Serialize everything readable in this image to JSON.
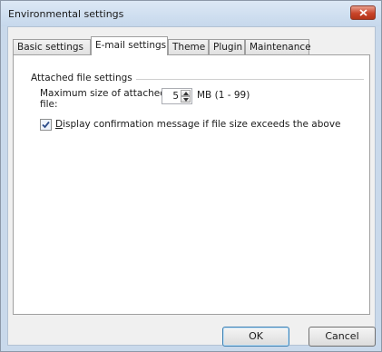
{
  "window": {
    "title": "Environmental settings"
  },
  "tabs": [
    {
      "label": "Basic settings"
    },
    {
      "label": "E-mail settings"
    },
    {
      "label": "Theme"
    },
    {
      "label": "Plugin"
    },
    {
      "label": "Maintenance"
    }
  ],
  "active_tab": "E-mail settings",
  "attached": {
    "group_title": "Attached file settings",
    "max_size_label_line1": "Maximum size of attached",
    "max_size_label_line2": "file:",
    "max_size_value": "5",
    "unit_text": "MB (1 - 99)",
    "confirm_checked": true,
    "confirm_label_accel": "D",
    "confirm_label_rest": "isplay confirmation message if file size exceeds the above"
  },
  "buttons": {
    "ok": "OK",
    "cancel": "Cancel"
  },
  "colors": {
    "accent": "#3c7fb1",
    "close": "#c9442a",
    "frame": "#c9d9eb"
  },
  "icons": [
    "close-icon",
    "spin-up-icon",
    "spin-down-icon",
    "checkmark-icon"
  ]
}
